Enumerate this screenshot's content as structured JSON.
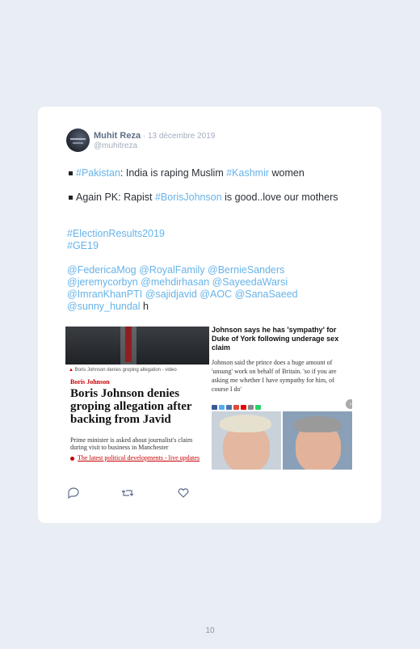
{
  "tweet": {
    "author": "Muhit Reza",
    "sep": " · ",
    "date": "13 décembre 2019",
    "handle": "@muhitreza",
    "line1": {
      "tag1": "#Pakistan",
      "mid": ": India is raping Muslim ",
      "tag2": "#Kashmir",
      "end": " women"
    },
    "line2": {
      "start": "Again PK: Rapist ",
      "tag": "#BorisJohnson",
      "end": " is good..love our mothers"
    },
    "hashtags": [
      "#ElectionResults2019",
      "#GE19"
    ],
    "mentions_line1": "@FedericaMog @RoyalFamily @BernieSanders",
    "mentions_line2": "@jeremycorbyn @mehdirhasan @SayeedaWarsi",
    "mentions_line3": "@ImranKhanPTI @sajidjavid @AOC @SanaSaeed",
    "mentions_line4_tag": "@sunny_hundal",
    "mentions_line4_end": " h"
  },
  "media": {
    "left": {
      "caption": "Boris Johnson denies groping allegation - video",
      "kicker": "Boris Johnson",
      "headline": "Boris Johnson denies groping allegation after backing from Javid",
      "standfirst": "Prime minister is asked about journalist's claim during visit to business in Manchester",
      "bullet": "The latest political developments - live updates"
    },
    "right": {
      "headline": "Johnson says he has 'sympathy' for Duke of York following underage sex claim",
      "body": "Johnson said the prince does a huge amount of 'unsung' work on behalf of Britain. 'so if you are asking me whether I have sympathy for him, of course I do'"
    }
  },
  "icons": {
    "reply": "reply-icon",
    "retweet": "retweet-icon",
    "like": "heart-icon"
  },
  "page_number": "10",
  "colors": {
    "hashtag": "#66b3e9",
    "background": "#e9edf4",
    "card": "#ffffff"
  }
}
